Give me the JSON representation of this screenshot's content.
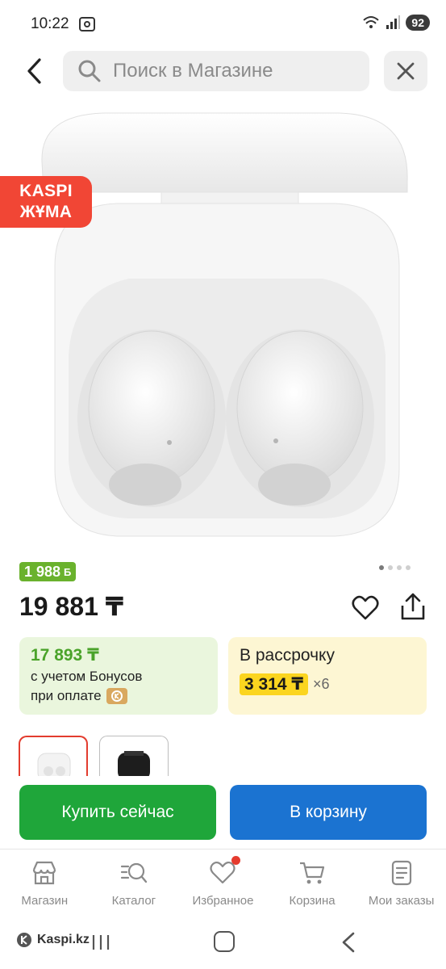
{
  "status_bar": {
    "time": "10:22",
    "battery": "92"
  },
  "header": {
    "search_placeholder": "Поиск в Магазине"
  },
  "promo_badge": {
    "line1": "KASPI",
    "line2": "ЖҰМА"
  },
  "bonus_chip": {
    "value": "1 988",
    "symbol": "Б"
  },
  "gallery": {
    "count": 4,
    "active_index": 0
  },
  "product": {
    "price": "19 881 ₸"
  },
  "bonus_card": {
    "price": "17 893 ₸",
    "line1": "с учетом Бонусов",
    "line2": "при оплате"
  },
  "credit_card": {
    "title": "В рассрочку",
    "monthly": "3 314 ₸",
    "multiplier": "×6"
  },
  "variants": [
    {
      "color": "white",
      "selected": true
    },
    {
      "color": "black",
      "selected": false
    }
  ],
  "actions": {
    "buy_now": "Купить сейчас",
    "add_to_cart": "В корзину"
  },
  "tabs": [
    {
      "label": "Магазин",
      "icon": "store-icon"
    },
    {
      "label": "Каталог",
      "icon": "catalog-search-icon"
    },
    {
      "label": "Избранное",
      "icon": "heart-icon",
      "has_notification": true
    },
    {
      "label": "Корзина",
      "icon": "cart-icon"
    },
    {
      "label": "Мои заказы",
      "icon": "orders-icon"
    }
  ],
  "nav": {
    "brand": "Kaspi.kz"
  },
  "colors": {
    "promo": "#f14635",
    "buy": "#1fa63a",
    "cart": "#1b73d1",
    "bonus_green": "#6ab22d",
    "credit_yellow": "#fbd51f"
  }
}
